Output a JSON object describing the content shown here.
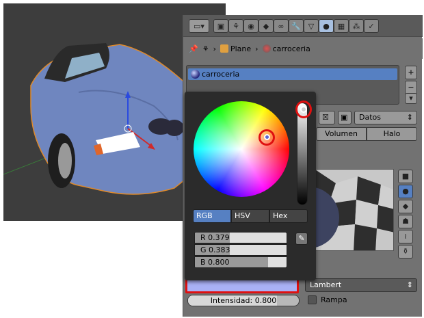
{
  "header": {
    "icons": [
      "render-icon",
      "scene-icon",
      "world-icon",
      "object-icon",
      "constraints-icon",
      "modifiers-icon",
      "data-icon",
      "material-icon",
      "texture-icon",
      "particles-icon",
      "physics-icon"
    ]
  },
  "breadcrumb": {
    "object": "Plane",
    "material": "carroceria"
  },
  "material_list": {
    "selected": "carroceria"
  },
  "tabs": {
    "volume": "Volumen",
    "halo": "Halo"
  },
  "data_select": "Datos",
  "picker": {
    "modes": [
      "RGB",
      "HSV",
      "Hex"
    ],
    "active_mode": "RGB",
    "r_label": "R 0.379",
    "g_label": "G 0.383",
    "b_label": "B 0.800",
    "r": 0.379,
    "g": 0.383,
    "b": 0.8
  },
  "diffuse": {
    "color": "#a9b1f5",
    "shader": "Lambert",
    "intensity_label": "Intensidad: 0.800",
    "intensity": 0.8,
    "ramp_label": "Rampa"
  },
  "colors": {
    "highlight": "#e01010",
    "accent": "#5680c2"
  }
}
